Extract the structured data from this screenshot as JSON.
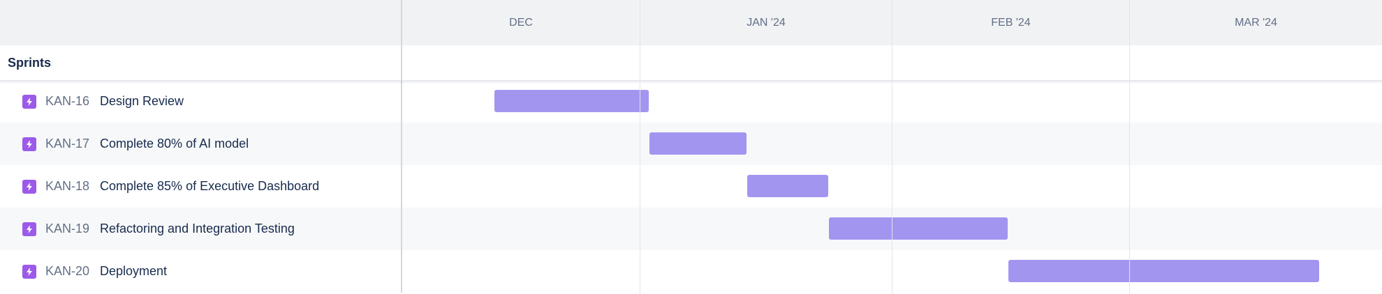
{
  "timeline": {
    "months": [
      "DEC",
      "JAN '24",
      "FEB '24",
      "MAR '24"
    ],
    "group_title": "Sprints",
    "rows": [
      {
        "key": "KAN-16",
        "title": "Design Review",
        "icon": "epic-lightning-icon",
        "bar_start": "early Dec",
        "bar_end": "start of Jan '24"
      },
      {
        "key": "KAN-17",
        "title": "Complete 80% of AI model",
        "icon": "epic-lightning-icon",
        "bar_start": "start of Jan '24",
        "bar_end": "mid Jan '24"
      },
      {
        "key": "KAN-18",
        "title": "Complete 85% of Executive Dashboard",
        "icon": "epic-lightning-icon",
        "bar_start": "mid Jan '24",
        "bar_end": "late Jan '24"
      },
      {
        "key": "KAN-19",
        "title": "Refactoring and Integration Testing",
        "icon": "epic-lightning-icon",
        "bar_start": "late Jan '24",
        "bar_end": "late Feb '24"
      },
      {
        "key": "KAN-20",
        "title": "Deployment",
        "icon": "epic-lightning-icon",
        "bar_start": "late Feb '24",
        "bar_end": "late Mar '24"
      }
    ],
    "colors": {
      "bar": "#a295f0",
      "epic_icon": "#9c5ae8",
      "header_bg": "#f1f2f4",
      "alt_row_bg": "#f7f8f9"
    }
  }
}
